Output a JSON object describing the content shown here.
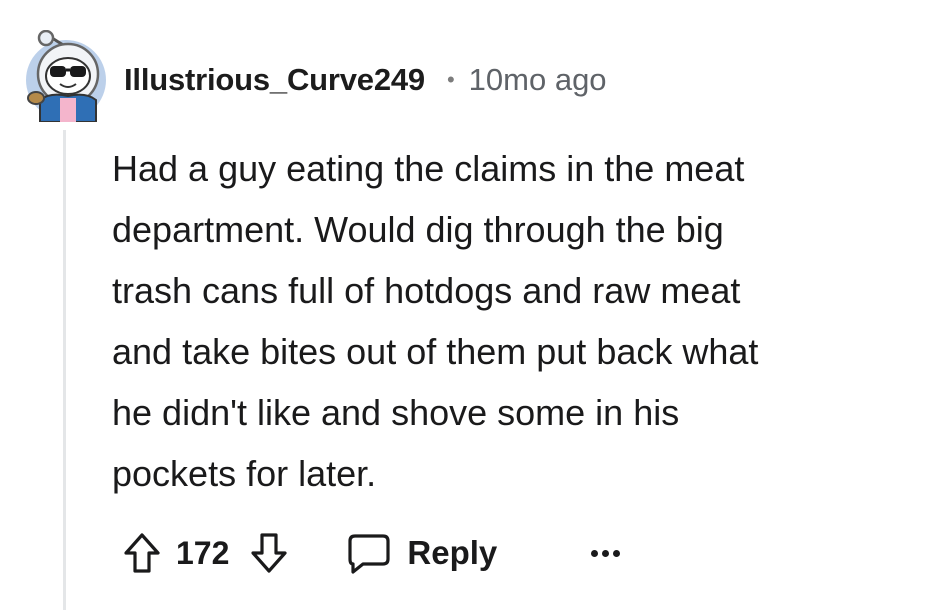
{
  "comment": {
    "username": "Illustrious_Curve249",
    "separator": "•",
    "timestamp": "10mo ago",
    "body_lines": [
      "Had a guy eating the claims in the meat",
      "department. Would dig through the big",
      "trash cans full of hotdogs and raw meat",
      "and take bites out of them put back what",
      "he didn't like and shove some in his",
      "pockets for later."
    ],
    "score": "172",
    "reply_label": "Reply"
  },
  "icons": {
    "avatar": "snoo-avatar-icon",
    "upvote": "arrow-up-icon",
    "downvote": "arrow-down-icon",
    "reply": "speech-bubble-icon",
    "more": "more-options-icon"
  },
  "colors": {
    "text": "#1a1a1b",
    "muted": "#5f6368",
    "thread_line": "#e4e6e8",
    "avatar_bg": "#bcd0ea",
    "avatar_jacket": "#2f6fb5",
    "avatar_shirt": "#f4b5cc"
  }
}
